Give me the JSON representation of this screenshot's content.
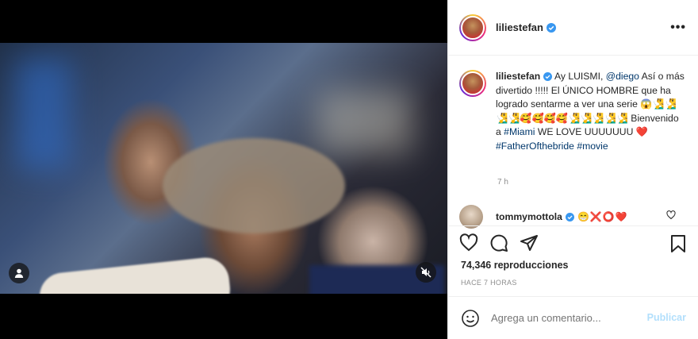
{
  "post": {
    "username": "liliestefan",
    "more_label": "•••"
  },
  "caption": {
    "part1": "Ay LUISMI, ",
    "mention": "@diego",
    "part2": " Así o más divertido !!!!! El ÚNICO HOMBRE que ha logrado sentarme a ver una serie 😱🧏‍♂️🧏‍♂️🧏‍♂️🧏‍♂️🥰🥰🥰🥰🧏‍♂️🧏‍♂️🧏‍♂️🧏‍♂️🧏‍♂️ Bienvenido a ",
    "tag1": "#Miami",
    "part3": " WE LOVE UUUUUUU ",
    "heart": "❤️",
    "tag2": "#FatherOfthebride",
    "tag3": "#movie",
    "time": "7 h"
  },
  "comment": {
    "username": "tommymottola",
    "text": "😁❌⭕❤️"
  },
  "stats": {
    "views": "74,346 reproducciones",
    "ago": "HACE 7 HORAS"
  },
  "compose": {
    "placeholder": "Agrega un comentario...",
    "publish": "Publicar"
  },
  "icons": {
    "user": "user-icon",
    "mute": "muted-speaker-icon",
    "like": "heart-icon",
    "comment": "comment-bubble-icon",
    "share": "paper-plane-icon",
    "save": "bookmark-icon",
    "emoji": "emoji-smile-icon",
    "verified": "verified-badge-icon"
  }
}
